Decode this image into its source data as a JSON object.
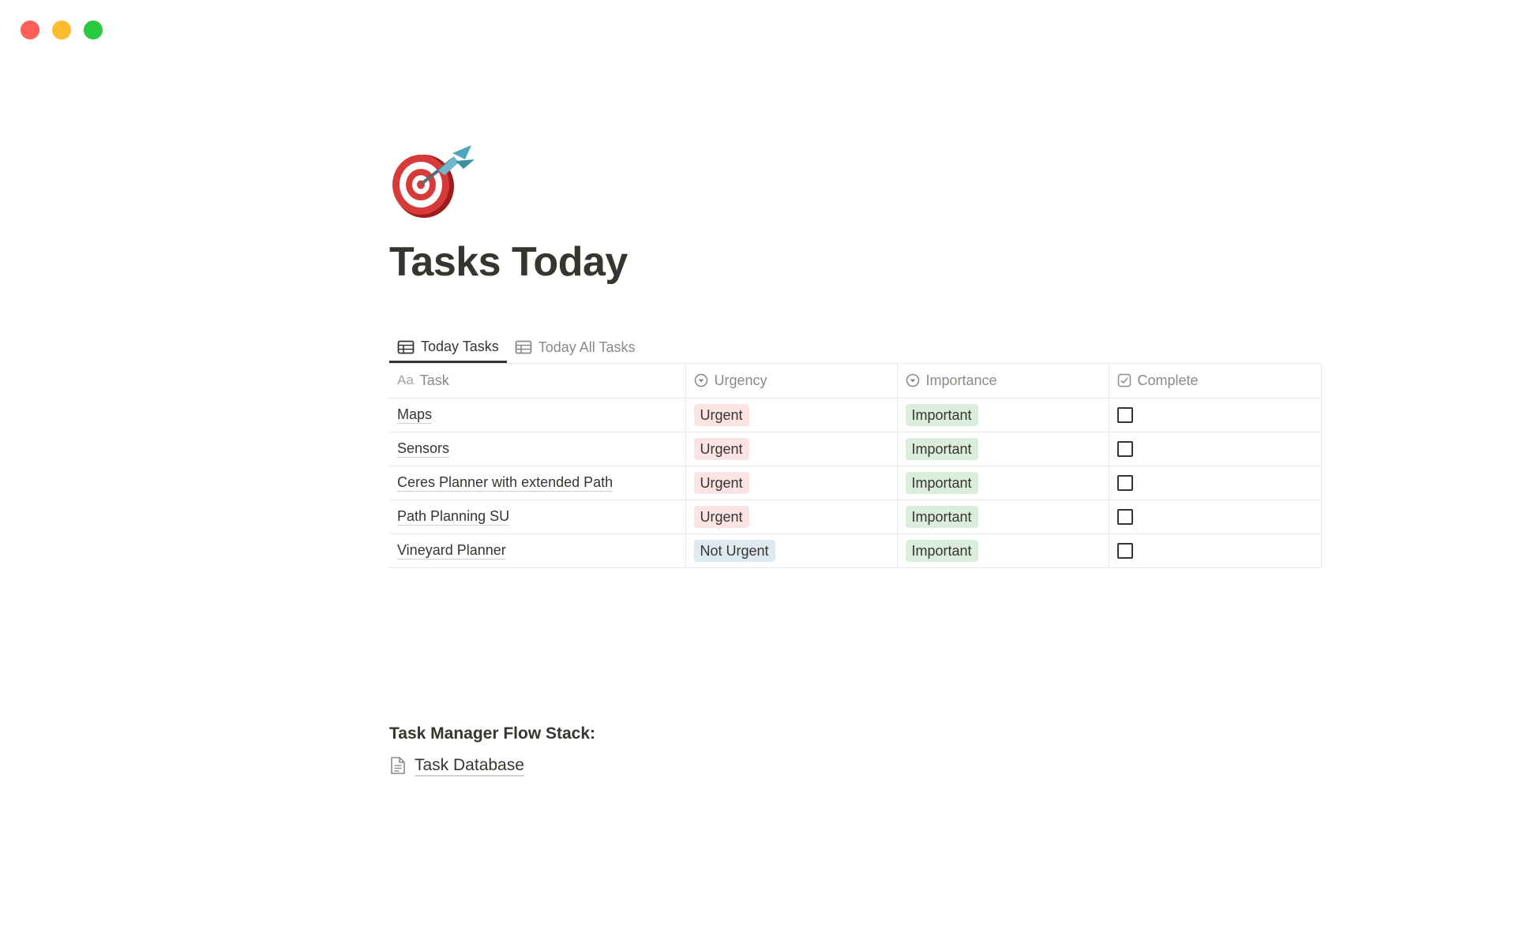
{
  "window": {
    "controls": {
      "close_color": "#ff5f57",
      "minimize_color": "#febc2e",
      "maximize_color": "#28c840"
    }
  },
  "page": {
    "icon": "dart-target-icon",
    "title": "Tasks Today"
  },
  "views": {
    "tabs": [
      {
        "label": "Today Tasks",
        "icon": "table-icon",
        "active": true
      },
      {
        "label": "Today All Tasks",
        "icon": "table-icon",
        "active": false
      }
    ]
  },
  "table": {
    "columns": [
      {
        "label": "Task",
        "icon": "Aa"
      },
      {
        "label": "Urgency",
        "icon": "select-icon"
      },
      {
        "label": "Importance",
        "icon": "select-icon"
      },
      {
        "label": "Complete",
        "icon": "checkbox-icon"
      }
    ],
    "rows": [
      {
        "task": "Maps",
        "urgency": "Urgent",
        "importance": "Important",
        "complete": false
      },
      {
        "task": "Sensors",
        "urgency": "Urgent",
        "importance": "Important",
        "complete": false
      },
      {
        "task": "Ceres Planner with extended Path",
        "urgency": "Urgent",
        "importance": "Important",
        "complete": false
      },
      {
        "task": "Path Planning SU",
        "urgency": "Urgent",
        "importance": "Important",
        "complete": false
      },
      {
        "task": "Vineyard Planner",
        "urgency": "Not Urgent",
        "importance": "Important",
        "complete": false
      }
    ]
  },
  "tag_colors": {
    "Urgent": "#fbe4e4",
    "Not Urgent": "#ddebf1",
    "Important": "#dbeddb"
  },
  "footer": {
    "heading": "Task Manager Flow Stack:",
    "link": {
      "label": "Task Database",
      "icon": "page-icon"
    }
  }
}
